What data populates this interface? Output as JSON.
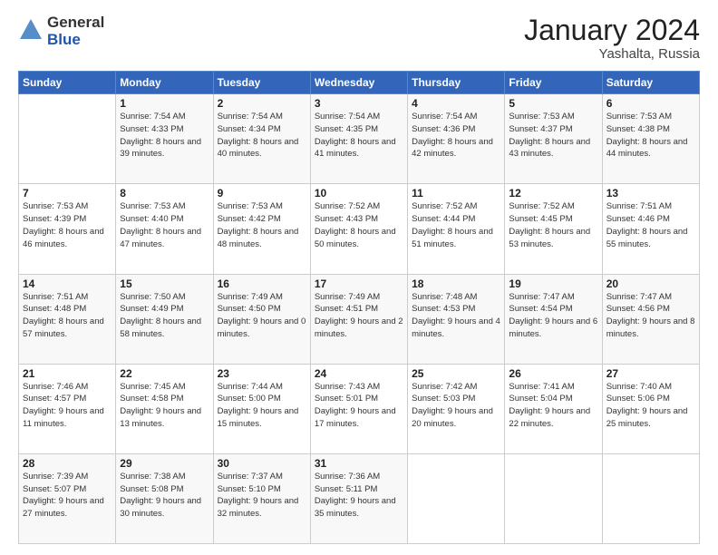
{
  "header": {
    "logo_general": "General",
    "logo_blue": "Blue",
    "title": "January 2024",
    "location": "Yashalta, Russia"
  },
  "weekdays": [
    "Sunday",
    "Monday",
    "Tuesday",
    "Wednesday",
    "Thursday",
    "Friday",
    "Saturday"
  ],
  "weeks": [
    [
      {
        "day": "",
        "sunrise": "",
        "sunset": "",
        "daylight": ""
      },
      {
        "day": "1",
        "sunrise": "Sunrise: 7:54 AM",
        "sunset": "Sunset: 4:33 PM",
        "daylight": "Daylight: 8 hours and 39 minutes."
      },
      {
        "day": "2",
        "sunrise": "Sunrise: 7:54 AM",
        "sunset": "Sunset: 4:34 PM",
        "daylight": "Daylight: 8 hours and 40 minutes."
      },
      {
        "day": "3",
        "sunrise": "Sunrise: 7:54 AM",
        "sunset": "Sunset: 4:35 PM",
        "daylight": "Daylight: 8 hours and 41 minutes."
      },
      {
        "day": "4",
        "sunrise": "Sunrise: 7:54 AM",
        "sunset": "Sunset: 4:36 PM",
        "daylight": "Daylight: 8 hours and 42 minutes."
      },
      {
        "day": "5",
        "sunrise": "Sunrise: 7:53 AM",
        "sunset": "Sunset: 4:37 PM",
        "daylight": "Daylight: 8 hours and 43 minutes."
      },
      {
        "day": "6",
        "sunrise": "Sunrise: 7:53 AM",
        "sunset": "Sunset: 4:38 PM",
        "daylight": "Daylight: 8 hours and 44 minutes."
      }
    ],
    [
      {
        "day": "7",
        "sunrise": "Sunrise: 7:53 AM",
        "sunset": "Sunset: 4:39 PM",
        "daylight": "Daylight: 8 hours and 46 minutes."
      },
      {
        "day": "8",
        "sunrise": "Sunrise: 7:53 AM",
        "sunset": "Sunset: 4:40 PM",
        "daylight": "Daylight: 8 hours and 47 minutes."
      },
      {
        "day": "9",
        "sunrise": "Sunrise: 7:53 AM",
        "sunset": "Sunset: 4:42 PM",
        "daylight": "Daylight: 8 hours and 48 minutes."
      },
      {
        "day": "10",
        "sunrise": "Sunrise: 7:52 AM",
        "sunset": "Sunset: 4:43 PM",
        "daylight": "Daylight: 8 hours and 50 minutes."
      },
      {
        "day": "11",
        "sunrise": "Sunrise: 7:52 AM",
        "sunset": "Sunset: 4:44 PM",
        "daylight": "Daylight: 8 hours and 51 minutes."
      },
      {
        "day": "12",
        "sunrise": "Sunrise: 7:52 AM",
        "sunset": "Sunset: 4:45 PM",
        "daylight": "Daylight: 8 hours and 53 minutes."
      },
      {
        "day": "13",
        "sunrise": "Sunrise: 7:51 AM",
        "sunset": "Sunset: 4:46 PM",
        "daylight": "Daylight: 8 hours and 55 minutes."
      }
    ],
    [
      {
        "day": "14",
        "sunrise": "Sunrise: 7:51 AM",
        "sunset": "Sunset: 4:48 PM",
        "daylight": "Daylight: 8 hours and 57 minutes."
      },
      {
        "day": "15",
        "sunrise": "Sunrise: 7:50 AM",
        "sunset": "Sunset: 4:49 PM",
        "daylight": "Daylight: 8 hours and 58 minutes."
      },
      {
        "day": "16",
        "sunrise": "Sunrise: 7:49 AM",
        "sunset": "Sunset: 4:50 PM",
        "daylight": "Daylight: 9 hours and 0 minutes."
      },
      {
        "day": "17",
        "sunrise": "Sunrise: 7:49 AM",
        "sunset": "Sunset: 4:51 PM",
        "daylight": "Daylight: 9 hours and 2 minutes."
      },
      {
        "day": "18",
        "sunrise": "Sunrise: 7:48 AM",
        "sunset": "Sunset: 4:53 PM",
        "daylight": "Daylight: 9 hours and 4 minutes."
      },
      {
        "day": "19",
        "sunrise": "Sunrise: 7:47 AM",
        "sunset": "Sunset: 4:54 PM",
        "daylight": "Daylight: 9 hours and 6 minutes."
      },
      {
        "day": "20",
        "sunrise": "Sunrise: 7:47 AM",
        "sunset": "Sunset: 4:56 PM",
        "daylight": "Daylight: 9 hours and 8 minutes."
      }
    ],
    [
      {
        "day": "21",
        "sunrise": "Sunrise: 7:46 AM",
        "sunset": "Sunset: 4:57 PM",
        "daylight": "Daylight: 9 hours and 11 minutes."
      },
      {
        "day": "22",
        "sunrise": "Sunrise: 7:45 AM",
        "sunset": "Sunset: 4:58 PM",
        "daylight": "Daylight: 9 hours and 13 minutes."
      },
      {
        "day": "23",
        "sunrise": "Sunrise: 7:44 AM",
        "sunset": "Sunset: 5:00 PM",
        "daylight": "Daylight: 9 hours and 15 minutes."
      },
      {
        "day": "24",
        "sunrise": "Sunrise: 7:43 AM",
        "sunset": "Sunset: 5:01 PM",
        "daylight": "Daylight: 9 hours and 17 minutes."
      },
      {
        "day": "25",
        "sunrise": "Sunrise: 7:42 AM",
        "sunset": "Sunset: 5:03 PM",
        "daylight": "Daylight: 9 hours and 20 minutes."
      },
      {
        "day": "26",
        "sunrise": "Sunrise: 7:41 AM",
        "sunset": "Sunset: 5:04 PM",
        "daylight": "Daylight: 9 hours and 22 minutes."
      },
      {
        "day": "27",
        "sunrise": "Sunrise: 7:40 AM",
        "sunset": "Sunset: 5:06 PM",
        "daylight": "Daylight: 9 hours and 25 minutes."
      }
    ],
    [
      {
        "day": "28",
        "sunrise": "Sunrise: 7:39 AM",
        "sunset": "Sunset: 5:07 PM",
        "daylight": "Daylight: 9 hours and 27 minutes."
      },
      {
        "day": "29",
        "sunrise": "Sunrise: 7:38 AM",
        "sunset": "Sunset: 5:08 PM",
        "daylight": "Daylight: 9 hours and 30 minutes."
      },
      {
        "day": "30",
        "sunrise": "Sunrise: 7:37 AM",
        "sunset": "Sunset: 5:10 PM",
        "daylight": "Daylight: 9 hours and 32 minutes."
      },
      {
        "day": "31",
        "sunrise": "Sunrise: 7:36 AM",
        "sunset": "Sunset: 5:11 PM",
        "daylight": "Daylight: 9 hours and 35 minutes."
      },
      {
        "day": "",
        "sunrise": "",
        "sunset": "",
        "daylight": ""
      },
      {
        "day": "",
        "sunrise": "",
        "sunset": "",
        "daylight": ""
      },
      {
        "day": "",
        "sunrise": "",
        "sunset": "",
        "daylight": ""
      }
    ]
  ]
}
